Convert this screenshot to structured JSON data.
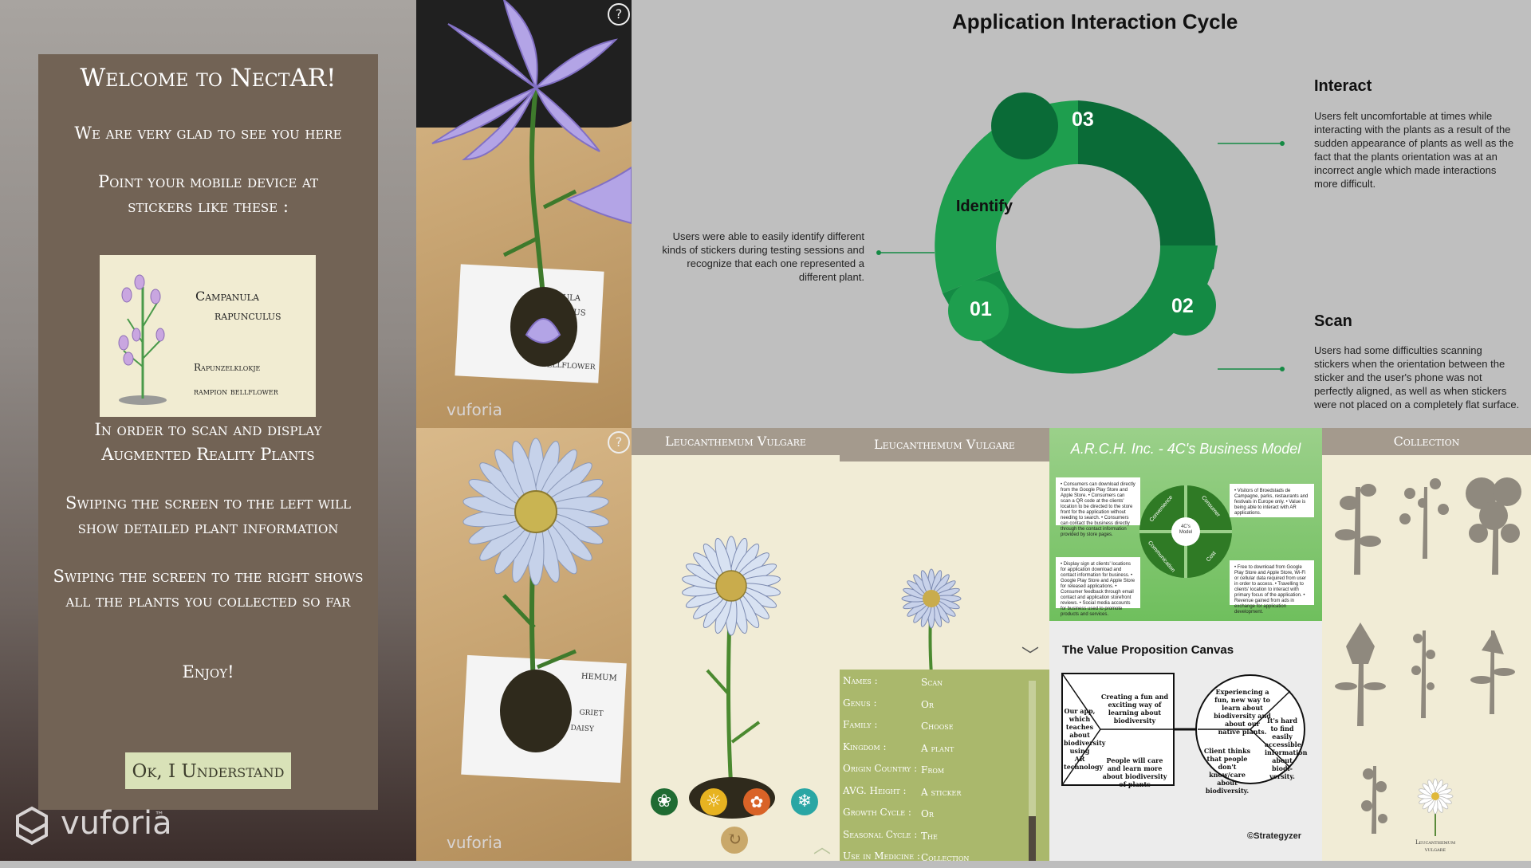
{
  "welcome": {
    "title": "Welcome to NectAR!",
    "glad": "We are very glad to see you here",
    "point": "Point your mobile device at stickers like these :",
    "sticker": {
      "name_line1": "Campanula",
      "name_line2": "rapunculus",
      "common1": "Rapunzelklokje",
      "common2": "rampion bellflower"
    },
    "scan": "In order to scan and display Augmented Reality Plants",
    "swipe_left": "Swiping the screen to the left will show detailed plant information",
    "swipe_right": "Swiping the screen to the right shows all the plants you collected so far",
    "enjoy": "Enjoy!",
    "ok_button": "Ok, I Understand",
    "vuforia": "vuforia",
    "tm": "™"
  },
  "photos": {
    "top_vuforia": "vuforia",
    "bottom_vuforia": "vuforia",
    "help": "?",
    "top_sticker": {
      "line1": "ULA",
      "line2": "ULUS",
      "line3": "BELLFLOWER"
    },
    "bottom_sticker": {
      "line1": "HEMUM",
      "line2": "GRIET",
      "line3": "DAISY"
    }
  },
  "cycle": {
    "title": "Application Interaction Cycle",
    "segments": [
      {
        "number": "01",
        "color": "#1e9e4e"
      },
      {
        "number": "02",
        "color": "#148a44"
      },
      {
        "number": "03",
        "color": "#0a6b37"
      }
    ],
    "identify": {
      "heading": "Identify",
      "text": "Users were able to easily identify different kinds of stickers during testing sessions and recognize that each one represented a different plant."
    },
    "interact": {
      "heading": "Interact",
      "text": "Users felt uncomfortable at times while interacting with the plants as a result of the sudden appearance of plants as well as the fact that the plants orientation was at an incorrect angle which made interactions more difficult."
    },
    "scan": {
      "heading": "Scan",
      "text": "Users had some difficulties scanning stickers when the orientation between the sticker and the user's phone was not perfectly aligned, as well as when stickers were not placed on a completely flat surface."
    }
  },
  "panel_daisy": {
    "header": "Leucanthemum Vulgare",
    "buttons": [
      "flower-button",
      "sun-button",
      "brain-button",
      "snowflake-button",
      "rotate-button"
    ]
  },
  "panel_info": {
    "header": "Leucanthemum Vulgare",
    "rows": [
      {
        "label": "Names :",
        "value": "Scan"
      },
      {
        "label": "Genus :",
        "value": "Or"
      },
      {
        "label": "Family :",
        "value": "Choose"
      },
      {
        "label": "Kingdom :",
        "value": "A plant"
      },
      {
        "label": "Origin Country :",
        "value": "From"
      },
      {
        "label": "AVG. Height :",
        "value": "A sticker"
      },
      {
        "label": "Growth Cycle :",
        "value": "Or"
      },
      {
        "label": "Seasonal Cycle :",
        "value": "The"
      },
      {
        "label": "Use in Medicine :",
        "value": "Collection"
      }
    ]
  },
  "business": {
    "title": "A.R.C.H. Inc. - 4C's Business Model",
    "center": "4C's Model",
    "quadrants": [
      "Convenience",
      "Consumer",
      "Communication",
      "Cost"
    ],
    "card_tl": "• Consumers can download directly from the Google Play Store and Apple Store. • Consumers can scan a QR code at the clients' location to be directed to the store front for the application without needing to search. • Consumers can contact the business directly through the contact information provided by store pages.",
    "card_tr": "• Visitors of Broedstads de Campagne, parks, restaurants and festivals in Europe only. • Value is being able to interact with AR applications.",
    "card_bl": "• Display sign at clients' locations for application download and contact information for business. • Google Play Store and Apple Store for released applications. • Consumer feedback through email contact and application storefront reviews. • Social media accounts for business used to promote products and services.",
    "card_br": "• Free to download from Google Play Store and Apple Store, Wi-Fi or cellular data required from user in order to access. • Travelling to clients' location to interact with primary focus of the application. • Revenue gained from ads in exchange for application development."
  },
  "vpc": {
    "title": "The Value Proposition Canvas",
    "left_text": "Our app, which teaches about biodiversity using AR technology",
    "gain_text": "Creating a fun and exciting way of learning about biodiversity",
    "pain_text": "People will care and learn more about biodiversity of plants",
    "circle_top": "Experiencing a fun, new way to learn about biodiversity and about our native plants.",
    "circle_right": "It's hard to find easily accessible information about biodi-versity.",
    "circle_left": "Client thinks that people don't know/care about biodiversity.",
    "brand": "Strategyzer"
  },
  "collection": {
    "header": "Collection",
    "item_label_1": "Leucanthemum",
    "item_label_2": "vulgare"
  }
}
